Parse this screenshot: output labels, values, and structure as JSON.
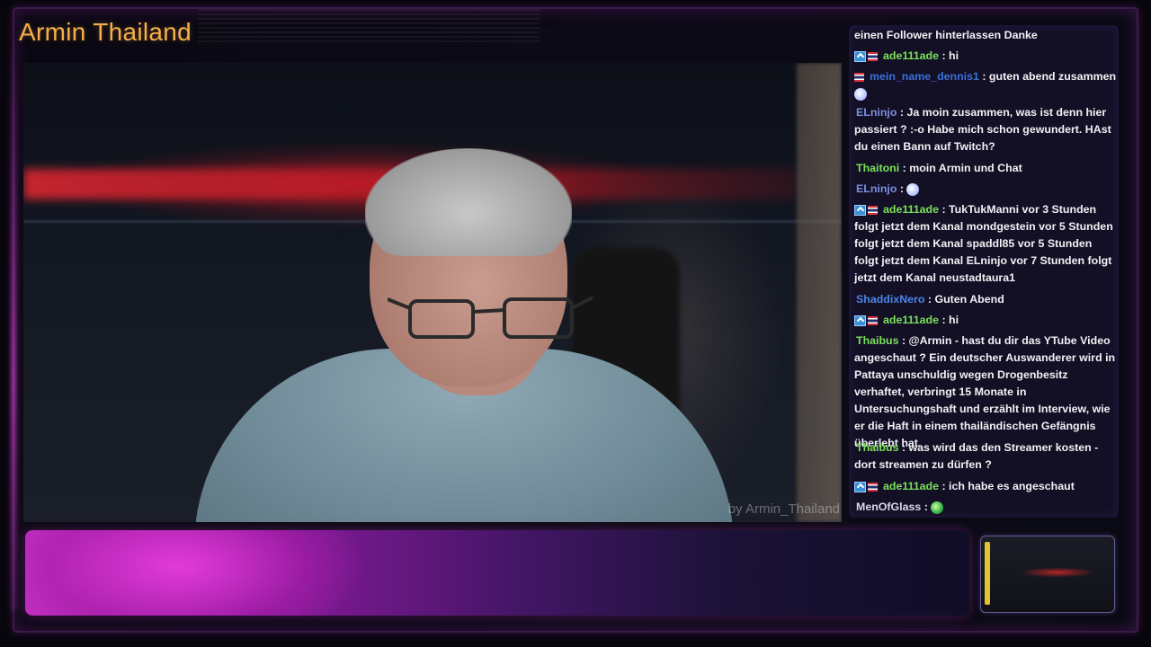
{
  "stream": {
    "title": "Armin Thailand",
    "watermark": "by Armin_Thailand"
  },
  "colors": {
    "title": "#f4b04a",
    "accent_magenta": "#c42fc1",
    "chat_text": "#f1f1f4"
  },
  "chat": {
    "messages": [
      {
        "user": "",
        "user_color": "#f1f1f4",
        "badges": [],
        "text": "einen Follower hinterlassen Danke",
        "emote": ""
      },
      {
        "user": "ade111ade",
        "user_color": "#7be05a",
        "badges": [
          "bits-badge",
          "thai-flag-badge"
        ],
        "text": ": hi",
        "emote": ""
      },
      {
        "user": "mein_name_dennis1",
        "user_color": "#3b6fd8",
        "badges": [
          "thai-flag-badge"
        ],
        "text": ": guten abend zusammen",
        "emote": "unicorn-emote"
      },
      {
        "user": "ELninjo",
        "user_color": "#7c8fe0",
        "badges": [],
        "text": ": Ja moin zusammen, was ist denn hier passiert ? :-o Habe mich schon gewundert. HAst du einen Bann auf Twitch?",
        "emote": ""
      },
      {
        "user": "Thaitoni",
        "user_color": "#7be05a",
        "badges": [],
        "text": ": moin Armin und Chat",
        "emote": ""
      },
      {
        "user": "ELninjo",
        "user_color": "#7c8fe0",
        "badges": [],
        "text": ":",
        "emote": "unicorn-emote"
      },
      {
        "user": "ade111ade",
        "user_color": "#7be05a",
        "badges": [
          "bits-badge",
          "thai-flag-badge"
        ],
        "text": ": TukTukManni vor 3 Stunden folgt jetzt dem Kanal mondgestein vor 5 Stunden folgt jetzt dem Kanal spaddl85 vor 5 Stunden folgt jetzt dem Kanal ELninjo vor 7 Stunden folgt jetzt dem Kanal neustadtaura1",
        "emote": ""
      },
      {
        "user": "ShaddixNero",
        "user_color": "#4a86e8",
        "badges": [],
        "text": ": Guten Abend",
        "emote": ""
      },
      {
        "user": "ade111ade",
        "user_color": "#7be05a",
        "badges": [
          "bits-badge",
          "thai-flag-badge"
        ],
        "text": ": hi",
        "emote": ""
      },
      {
        "user": "Thaibus",
        "user_color": "#7be05a",
        "badges": [],
        "text": ": @Armin - hast du dir das YTube Video angeschaut ? Ein deutscher Auswanderer wird in Pattaya unschuldig wegen Drogenbesitz verhaftet, verbringt 15 Monate in Untersuchungshaft und erzählt im Interview, wie er die Haft in einem thailändischen Gefängnis überlebt hat.",
        "emote": ""
      },
      {
        "user": "Thaibus",
        "user_color": "#7be05a",
        "badges": [],
        "text": ": was wird das den Streamer kosten - dort streamen zu dürfen ?",
        "emote": ""
      },
      {
        "user": "ade111ade",
        "user_color": "#7be05a",
        "badges": [
          "bits-badge",
          "thai-flag-badge"
        ],
        "text": ": ich habe es angeschaut",
        "emote": ""
      },
      {
        "user": "MenOfGlass",
        "user_color": "#d9d9e6",
        "badges": [],
        "text": ":",
        "emote": "green-emote"
      }
    ]
  }
}
